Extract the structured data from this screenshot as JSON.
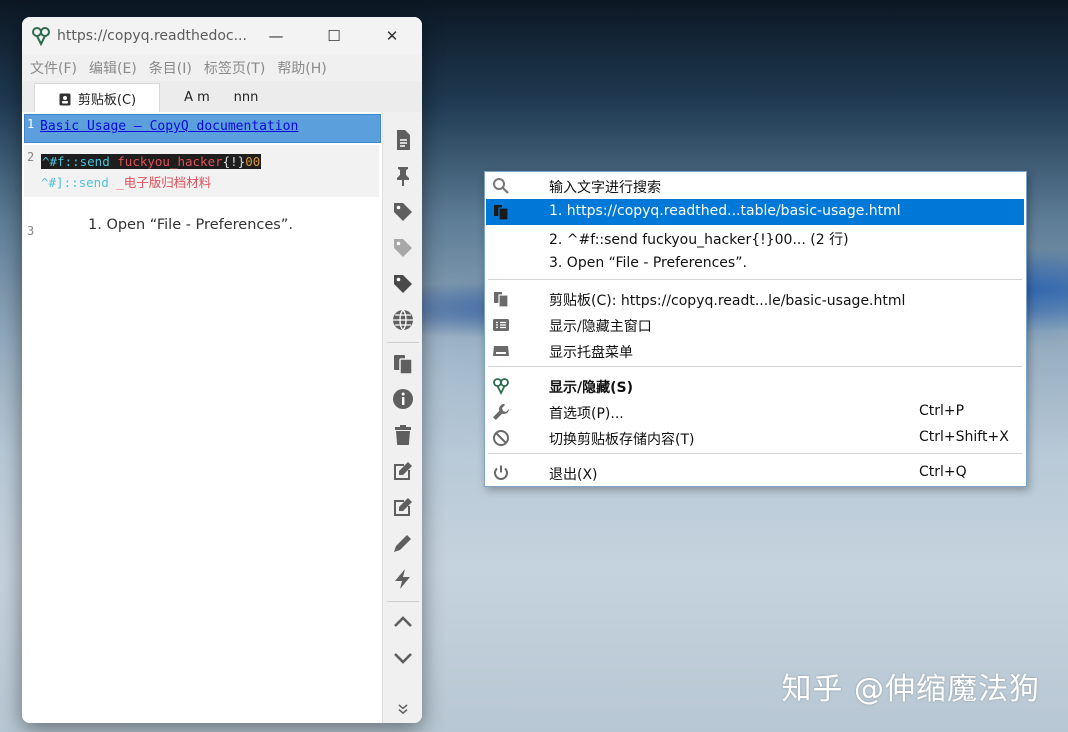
{
  "window": {
    "title": "https://copyq.readthedoc...",
    "controls": {
      "minimize": "—",
      "maximize": "☐",
      "close": "✕"
    },
    "menu": [
      "文件(F)",
      "编辑(E)",
      "条目(I)",
      "标签页(T)",
      "帮助(H)"
    ],
    "tabs": [
      {
        "label": "剪贴板(C)",
        "icon": "clipboard-icon"
      },
      {
        "label": "A m",
        "icon": ""
      },
      {
        "label": "nnn",
        "icon": ""
      }
    ],
    "items": [
      {
        "num": "1",
        "text": "Basic Usage — CopyQ documentation"
      },
      {
        "num": "2",
        "line1": {
          "a": "^#f::send ",
          "b": "fuckyou_hacker",
          "c": "{!}",
          "d": "00"
        },
        "line2": {
          "a": "^#]::send ",
          "b": "_电子版归档材料"
        }
      },
      {
        "num": "3",
        "text": "1. Open “File - Preferences”."
      }
    ],
    "toolbar_icons": [
      "new-item-icon",
      "pin-icon",
      "tag-icon",
      "tag-light-icon",
      "tag-dark-icon",
      "globe-icon",
      "copy-icon",
      "info-icon",
      "trash-icon",
      "edit-icon",
      "edit-external-icon",
      "pencil-icon",
      "lightning-icon",
      "chevron-up-icon",
      "chevron-down-icon",
      "more-icon"
    ]
  },
  "context_menu": {
    "items": [
      {
        "icon": "search-icon",
        "label": "输入文字进行搜索",
        "shortcut": ""
      },
      {
        "icon": "clipboard-stack-icon",
        "label": "1. https://copyq.readthed...table/basic-usage.html",
        "shortcut": "",
        "selected": true
      },
      {
        "icon": "",
        "label": "2. ^#f::send fuckyou_hacker{!}00... (2 行)",
        "shortcut": ""
      },
      {
        "icon": "",
        "label": "3. Open “File - Preferences”.",
        "shortcut": ""
      },
      {
        "icon": "clipboard-stack-icon",
        "label": "剪贴板(C): https://copyq.readt...le/basic-usage.html",
        "shortcut": ""
      },
      {
        "icon": "list-icon",
        "label": "显示/隐藏主窗口",
        "shortcut": ""
      },
      {
        "icon": "tray-icon",
        "label": "显示托盘菜单",
        "shortcut": ""
      },
      {
        "icon": "copyq-logo-icon",
        "label": "显示/隐藏(S)",
        "shortcut": "",
        "bold": true
      },
      {
        "icon": "wrench-icon",
        "label": "首选项(P)...",
        "shortcut": "Ctrl+P"
      },
      {
        "icon": "ban-icon",
        "label": "切换剪贴板存储内容(T)",
        "shortcut": "Ctrl+Shift+X"
      },
      {
        "icon": "power-icon",
        "label": "退出(X)",
        "shortcut": "Ctrl+Q"
      }
    ]
  },
  "watermark": "知乎 @伸缩魔法狗",
  "colors": {
    "selection": "#0078d7",
    "item_selected": "#5b9fdc",
    "link": "#0b0bd8"
  }
}
